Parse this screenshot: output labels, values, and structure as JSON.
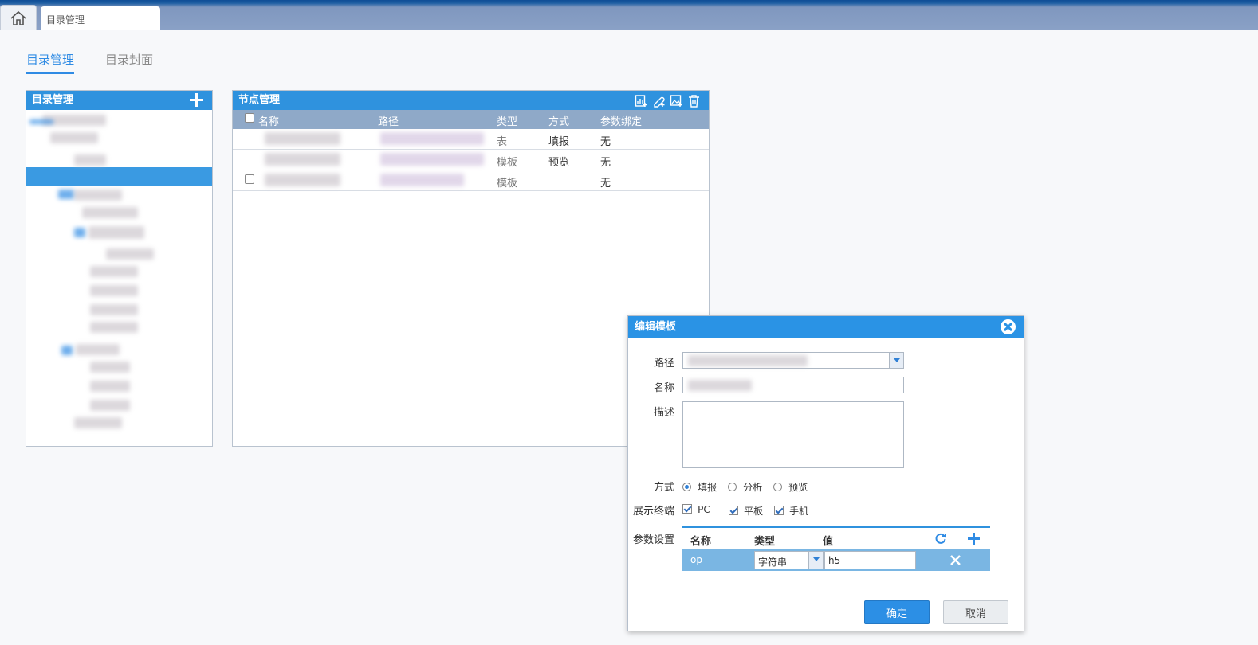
{
  "tabs": {
    "home": "home",
    "active_tab": "目录管理"
  },
  "subtabs": [
    "目录管理",
    "目录封面"
  ],
  "catalog_panel": {
    "title": "目录管理"
  },
  "node_panel": {
    "title": "节点管理",
    "columns": [
      "名称",
      "路径",
      "类型",
      "方式",
      "参数绑定"
    ],
    "rows": [
      {
        "type": "表",
        "mode": "填报",
        "binding": "无"
      },
      {
        "type": "模板",
        "mode": "预览",
        "binding": "无"
      },
      {
        "type": "模板",
        "mode": "",
        "binding": "无"
      }
    ]
  },
  "dialog": {
    "title": "编辑模板",
    "path_label": "路径",
    "name_label": "名称",
    "desc_label": "描述",
    "mode_label": "方式",
    "modes": [
      "填报",
      "分析",
      "预览"
    ],
    "terminal_label": "展示终端",
    "terminals": [
      "PC",
      "平板",
      "手机"
    ],
    "param_label": "参数设置",
    "param_columns": [
      "名称",
      "类型",
      "值"
    ],
    "param_row": {
      "name": "op",
      "type": "字符串",
      "value": "h5"
    },
    "ok": "确定",
    "cancel": "取消"
  }
}
